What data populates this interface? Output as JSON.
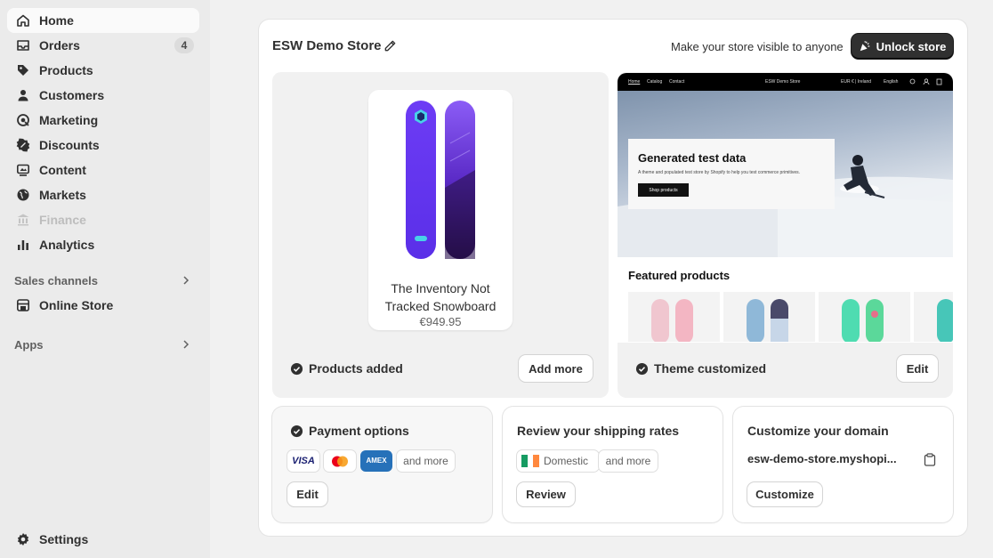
{
  "sidebar": {
    "items": [
      {
        "label": "Home",
        "icon": "home-icon"
      },
      {
        "label": "Orders",
        "icon": "orders-icon",
        "badge": "4"
      },
      {
        "label": "Products",
        "icon": "tag-icon"
      },
      {
        "label": "Customers",
        "icon": "person-icon"
      },
      {
        "label": "Marketing",
        "icon": "target-icon"
      },
      {
        "label": "Discounts",
        "icon": "discount-icon"
      },
      {
        "label": "Content",
        "icon": "content-icon"
      },
      {
        "label": "Markets",
        "icon": "globe-icon"
      },
      {
        "label": "Finance",
        "icon": "bank-icon"
      },
      {
        "label": "Analytics",
        "icon": "chart-icon"
      }
    ],
    "sales_channels_label": "Sales channels",
    "online_store_label": "Online Store",
    "apps_label": "Apps",
    "settings_label": "Settings"
  },
  "header": {
    "store_name": "ESW Demo Store",
    "visibility_text": "Make your store visible to anyone",
    "unlock_label": "Unlock store"
  },
  "products_panel": {
    "product_name": "The Inventory Not Tracked Snowboard",
    "product_price": "€949.95",
    "status": "Products added",
    "button": "Add more"
  },
  "theme_panel": {
    "nav_links": [
      "Home",
      "Catalog",
      "Contact"
    ],
    "nav_brand": "ESW Demo Store",
    "nav_currency": "EUR € | Ireland",
    "nav_language": "English",
    "hero_title": "Generated test data",
    "hero_subtitle": "A theme and populated test store by Shopify to help you test commerce primitives.",
    "hero_button": "Shop products",
    "featured_title": "Featured products",
    "status": "Theme customized",
    "button": "Edit"
  },
  "payment_card": {
    "title": "Payment options",
    "chips": [
      "VISA",
      "Mastercard",
      "AMEX"
    ],
    "more": "and more",
    "button": "Edit"
  },
  "shipping_card": {
    "title": "Review your shipping rates",
    "domestic": "Domestic",
    "more": "and more",
    "button": "Review"
  },
  "domain_card": {
    "title": "Customize your domain",
    "domain": "esw-demo-store.myshopi...",
    "button": "Customize"
  },
  "colors": {
    "accent_dark": "#303030",
    "snowboard_purple": "#6b3ff2"
  }
}
